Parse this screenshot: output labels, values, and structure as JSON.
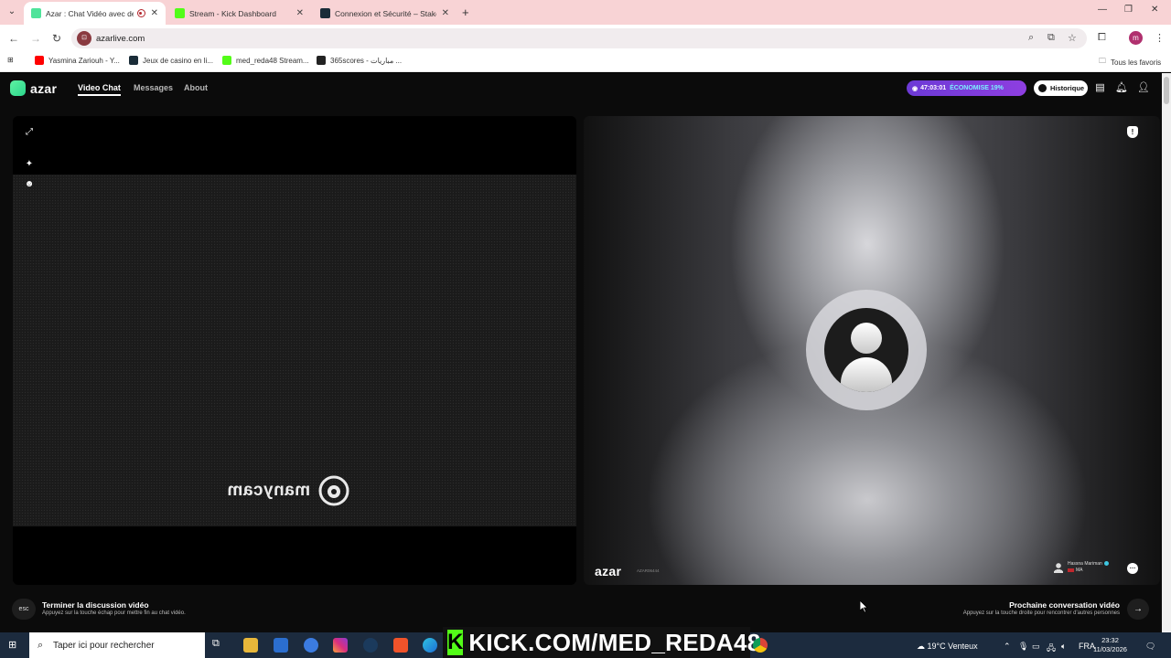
{
  "browser": {
    "tabs": [
      {
        "title": "Azar : Chat Vidéo avec des inconnus",
        "active": true
      },
      {
        "title": "Stream - Kick Dashboard",
        "active": false
      },
      {
        "title": "Connexion et Sécurité – Stake.com",
        "active": false
      }
    ],
    "url": "azarlive.com",
    "site_icon": "azar",
    "profile_initial": "m",
    "bookmarks": [
      {
        "label": "Yasmina Zariouh - Y..."
      },
      {
        "label": "Jeux de casino en li..."
      },
      {
        "label": "med_reda48 Stream..."
      },
      {
        "label": "365scores - مباريات ..."
      }
    ],
    "all_bookmarks": "Tous les favoris"
  },
  "azar": {
    "logo": "azar",
    "nav": [
      "Video Chat",
      "Messages",
      "About"
    ],
    "timer": "47:03:01",
    "economy": "ÉCONOMISE 19%",
    "history_label": "Historique",
    "manycam_text": "manycam",
    "watermark": "azar",
    "watermark_id": "AZAR06444",
    "peer": {
      "name": "Hassna Mariman",
      "country": "MA"
    },
    "end": {
      "key": "esc",
      "title": "Terminer la discussion vidéo",
      "subtitle": "Appuyez sur la touche échap pour mettre fin au chat vidéo."
    },
    "next": {
      "key": "→",
      "title": "Prochaine conversation vidéo",
      "subtitle": "Appuyez sur la touche droite pour rencontrer d'autres personnes"
    }
  },
  "taskbar": {
    "search_placeholder": "Taper ici pour rechercher",
    "kick_banner": "KICK.COM/MED_REDA48",
    "weather": "19°C  Venteux",
    "language": "FRA",
    "time": "23:32",
    "date": "11/03/2026"
  }
}
